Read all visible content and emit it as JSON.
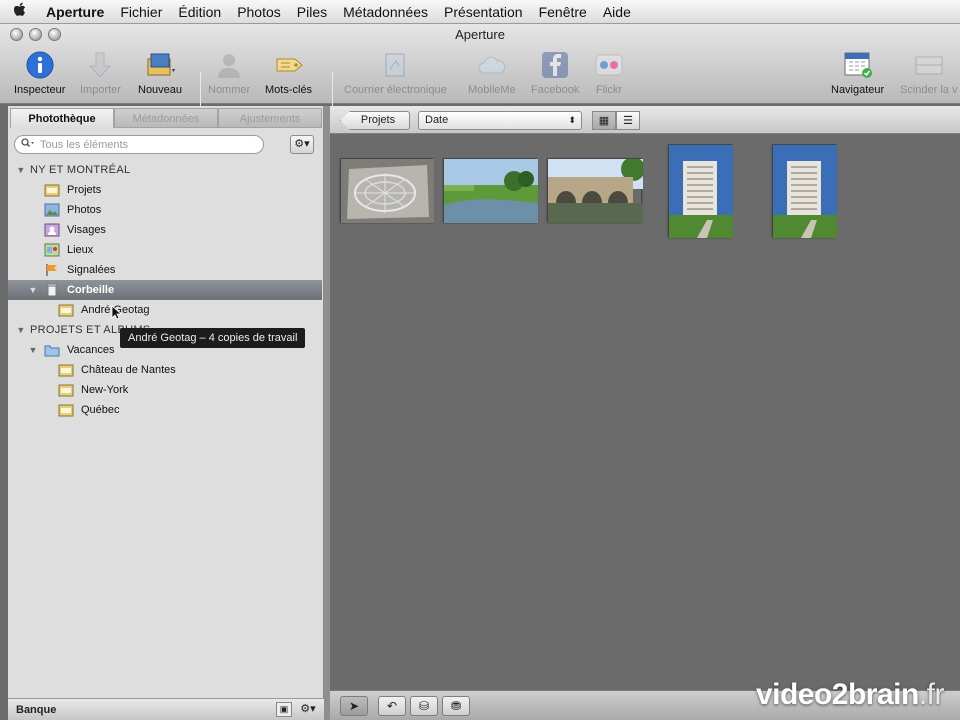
{
  "menubar": {
    "apple_icon": "apple-logo",
    "items": [
      "Aperture",
      "Fichier",
      "Édition",
      "Photos",
      "Piles",
      "Métadonnées",
      "Présentation",
      "Fenêtre",
      "Aide"
    ]
  },
  "window": {
    "title": "Aperture"
  },
  "toolbar": {
    "inspecteur": "Inspecteur",
    "importer": "Importer",
    "nouveau": "Nouveau",
    "nommer": "Nommer",
    "motscles": "Mots-clés",
    "courriel": "Courrier électronique",
    "mobileme": "MobileMe",
    "facebook": "Facebook",
    "flickr": "Flickr",
    "navigateur": "Navigateur",
    "scinder": "Scinder la v"
  },
  "sidebar": {
    "tabs": [
      "Photothèque",
      "Métadonnées",
      "Ajustements"
    ],
    "search_placeholder": "Tous les éléments",
    "library_header": "NY ET MONTRÉAL",
    "library_items": [
      "Projets",
      "Photos",
      "Visages",
      "Lieux",
      "Signalées",
      "Corbeille"
    ],
    "trash_child": "André Geotag",
    "projects_header": "PROJETS ET ALBUMS",
    "folder": "Vacances",
    "folder_items": [
      "Château de Nantes",
      "New-York",
      "Québec"
    ],
    "footer_label": "Banque"
  },
  "tooltip": "André Geotag – 4 copies de travail",
  "browser": {
    "breadcrumb": "Projets",
    "sort_value": "Date",
    "thumbnails": [
      "compass-drawing",
      "river-meadow",
      "stone-bridge",
      "apartment-tower",
      "apartment-tower-copy"
    ]
  },
  "watermark": {
    "brand": "video2brain",
    "tld": ".fr"
  }
}
